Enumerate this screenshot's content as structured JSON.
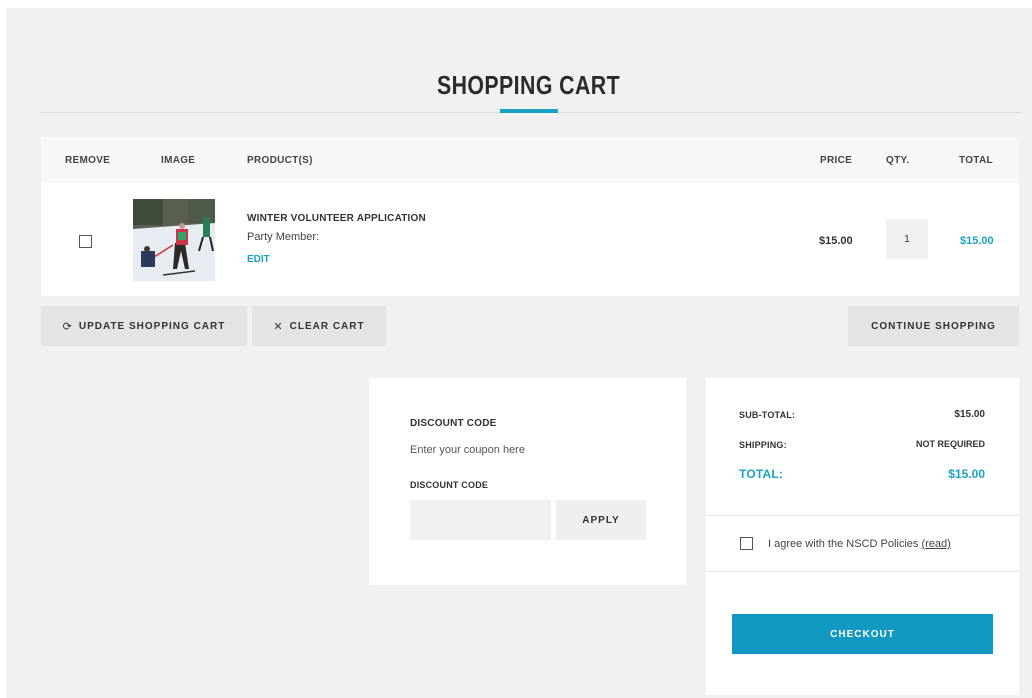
{
  "page": {
    "title": "SHOPPING CART"
  },
  "table": {
    "headers": {
      "remove": "REMOVE",
      "image": "IMAGE",
      "products": "PRODUCT(S)",
      "price": "PRICE",
      "qty": "QTY.",
      "total": "TOTAL"
    },
    "rows": [
      {
        "name": "WINTER VOLUNTEER APPLICATION",
        "meta": "Party Member:",
        "edit": "EDIT",
        "price": "$15.00",
        "qty": "1",
        "total": "$15.00"
      }
    ]
  },
  "actions": {
    "update": "UPDATE SHOPPING CART",
    "clear": "CLEAR CART",
    "continue": "CONTINUE SHOPPING"
  },
  "discount": {
    "heading": "DISCOUNT CODE",
    "hint": "Enter your coupon here",
    "field_label": "DISCOUNT CODE",
    "value": "",
    "apply": "APPLY"
  },
  "summary": {
    "subtotal_label": "SUB-TOTAL:",
    "subtotal": "$15.00",
    "shipping_label": "SHIPPING:",
    "shipping": "NOT REQUIRED",
    "total_label": "TOTAL:",
    "total": "$15.00",
    "agree_text": "I agree with the NSCD Policies",
    "agree_link": "(read)",
    "checkout": "CHECKOUT"
  },
  "colors": {
    "accent": "#1aa3c4",
    "checkout": "#1199c2",
    "page_bg": "#f1f1f1"
  },
  "icons": {
    "update": "refresh-icon",
    "clear": "close-icon"
  }
}
